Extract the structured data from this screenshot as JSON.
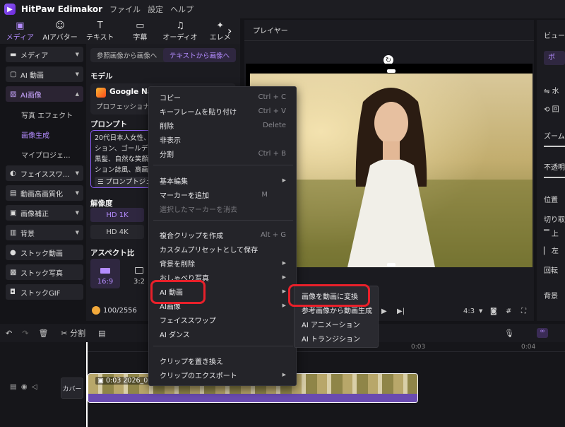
{
  "app": {
    "name": "HitPaw Edimakor",
    "menu": [
      "ファイル",
      "設定",
      "ヘルプ"
    ]
  },
  "toptabs": [
    {
      "label": "メディア",
      "icon": "media-icon"
    },
    {
      "label": "AIアバター",
      "icon": "avatar-icon"
    },
    {
      "label": "テキスト",
      "icon": "text-icon"
    },
    {
      "label": "字幕",
      "icon": "subtitle-icon"
    },
    {
      "label": "オーディオ",
      "icon": "audio-icon"
    },
    {
      "label": "エレメ",
      "icon": "element-icon"
    }
  ],
  "sidebar": {
    "items": [
      {
        "label": "メディア",
        "caret": "▼"
      },
      {
        "label": "AI 動画",
        "caret": "▼"
      },
      {
        "label": "AI画像",
        "caret": "▲"
      }
    ],
    "subitems": [
      "写真 エフェクト",
      "画像生成",
      "マイプロジェ..."
    ],
    "items2": [
      {
        "label": "フェイススワ...",
        "caret": "▼"
      },
      {
        "label": "動画高画質化",
        "caret": "▼"
      },
      {
        "label": "画像補正",
        "caret": "▼"
      },
      {
        "label": "背景",
        "caret": "▼"
      },
      {
        "label": "ストック動画",
        "caret": ""
      },
      {
        "label": "ストック写真",
        "caret": ""
      },
      {
        "label": "ストックGIF",
        "caret": ""
      }
    ]
  },
  "panel": {
    "tabs": [
      "参照画像から画像へ",
      "テキストから画像へ"
    ],
    "model_label": "モデル",
    "model_name": "Google Nan",
    "model_sub": "プロフェッショナ",
    "prompt_label": "プロンプト",
    "prompt_lines": [
      "20代日本人女性、日",
      "ション、ゴールデン",
      "黒髪、自然な笑顔、",
      "ション誌風、高画質"
    ],
    "prompt_button": "プロンプトジェ",
    "res_label": "解像度",
    "res_options": [
      "HD 1K",
      "HD 4K"
    ],
    "aspect_label": "アスペクト比",
    "aspects": [
      "16:9",
      "3:2"
    ],
    "credits": "100/2556"
  },
  "player": {
    "title": "プレイヤー",
    "ratio": "4:3"
  },
  "rightpanel": {
    "tab": "ビュー",
    "btn": "ボ",
    "items": [
      "水",
      "回",
      "ズーム",
      "不透明",
      "位置",
      "切り取",
      "上",
      "左",
      "回転",
      "背景"
    ]
  },
  "timeline": {
    "split": "分割",
    "cover": "カバー",
    "clip_time": "0:03",
    "clip_name": "2026_04",
    "ticks": [
      "0:03",
      "0:04"
    ]
  },
  "contextmenu": {
    "items": [
      {
        "label": "コピー",
        "shortcut": "Ctrl + C"
      },
      {
        "label": "キーフレームを貼り付け",
        "shortcut": "Ctrl + V"
      },
      {
        "label": "削除",
        "shortcut": "Delete"
      },
      {
        "label": "非表示",
        "shortcut": ""
      },
      {
        "label": "分割",
        "shortcut": "Ctrl + B"
      },
      {
        "label": "基本編集",
        "arrow": "▶"
      },
      {
        "label": "マーカーを追加",
        "shortcut": "M"
      },
      {
        "label": "選択したマーカーを消去",
        "shortcut": ""
      },
      {
        "label": "複合クリップを作成",
        "shortcut": "Alt + G"
      },
      {
        "label": "カスタムプリセットとして保存",
        "shortcut": ""
      },
      {
        "label": "背景を削除",
        "arrow": "▶"
      },
      {
        "label": "おしゃべり写真",
        "arrow": "▶"
      },
      {
        "label": "AI 動画",
        "arrow": "▶"
      },
      {
        "label": "AI画像",
        "arrow": "▶"
      },
      {
        "label": "フェイススワップ",
        "arrow": ""
      },
      {
        "label": "AI ダンス",
        "arrow": ""
      },
      {
        "label": "クリップを置き換え",
        "arrow": ""
      },
      {
        "label": "クリップのエクスポート",
        "arrow": "▶"
      }
    ]
  },
  "submenu": {
    "items": [
      "画像を動画に変換",
      "参考画像から動画生成",
      "AI アニメーション",
      "AI トランジション"
    ]
  },
  "colors": {
    "accent": "#8b5cf6",
    "highlight": "#e8202a"
  }
}
